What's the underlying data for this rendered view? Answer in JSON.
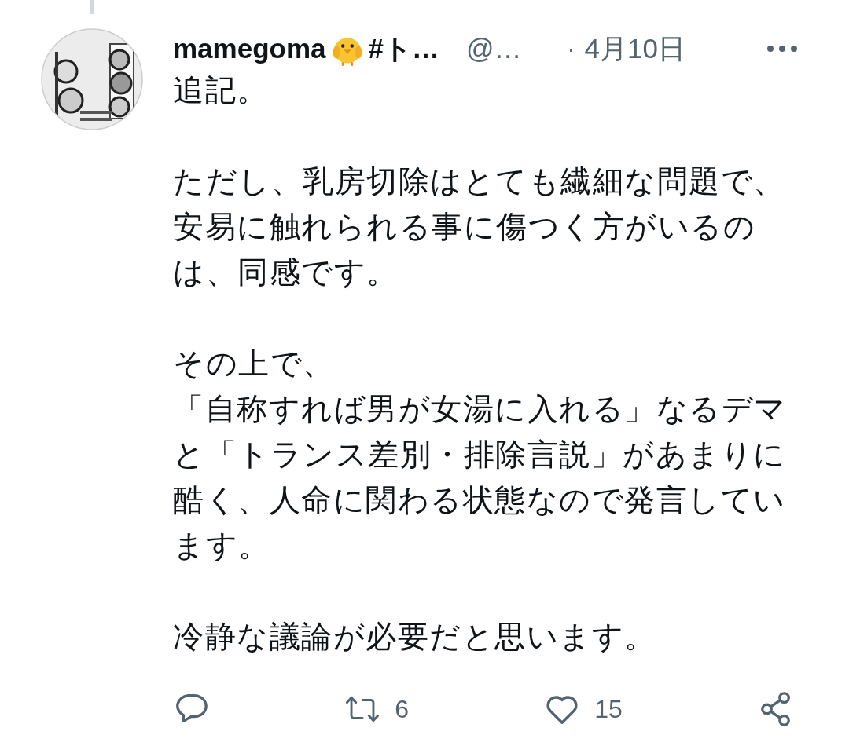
{
  "tweet": {
    "display_name": "mamegoma",
    "display_name_rest": "#ト…",
    "handle": "@…",
    "separator": "·",
    "date": "4月10日",
    "paragraphs": [
      [
        "追記。"
      ],
      [
        "ただし、乳房切除はとても繊細な問題で、",
        "安易に触れられる事に傷つく方がいるの",
        "は、同感です。"
      ],
      [
        "その上で、",
        "「自称すれば男が女湯に入れる」なるデマ",
        "と「トランス差別・排除言説」があまりに",
        "酷く、人命に関わる状態なので発言してい",
        "ます。"
      ],
      [
        "冷静な議論が必要だと思います。"
      ]
    ],
    "retweets": "6",
    "likes": "15"
  }
}
